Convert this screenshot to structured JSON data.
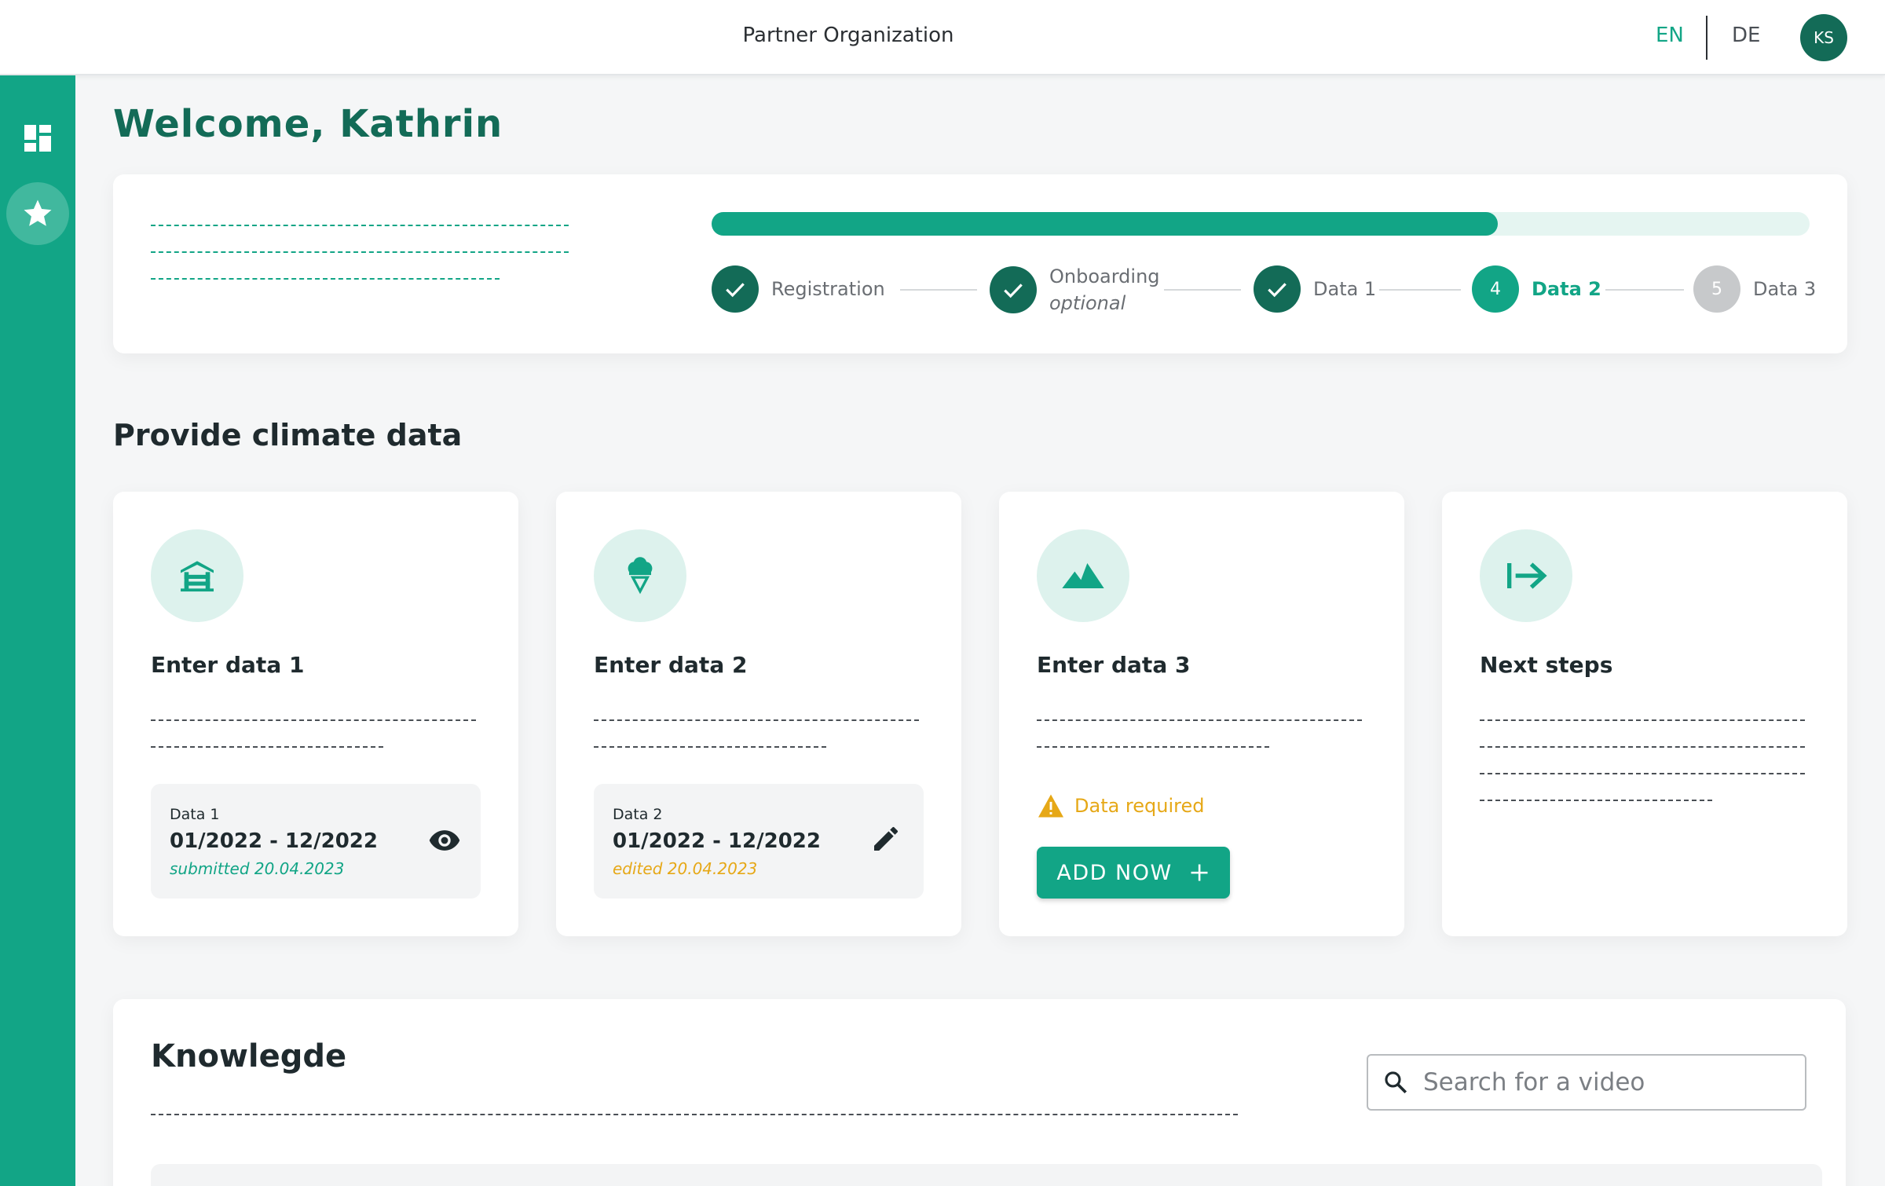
{
  "header": {
    "org_name": "Partner Organization",
    "lang_en": "EN",
    "lang_de": "DE",
    "avatar_initials": "KS"
  },
  "sidebar": {
    "items": [
      {
        "icon": "dashboard-icon"
      },
      {
        "icon": "star-icon"
      }
    ]
  },
  "welcome": "Welcome, Kathrin",
  "progress": {
    "fraction": 0.716,
    "steps": [
      {
        "label": "Registration",
        "state": "done"
      },
      {
        "label": "Onboarding",
        "sublabel": "optional",
        "state": "done"
      },
      {
        "label": "Data 1",
        "state": "done"
      },
      {
        "number": "4",
        "label": "Data 2",
        "state": "active"
      },
      {
        "number": "5",
        "label": "Data 3",
        "state": "todo"
      }
    ]
  },
  "section_title": "Provide climate data",
  "tiles": [
    {
      "icon": "cabin-icon",
      "title": "Enter data 1",
      "box_label": "Data 1",
      "box_range": "01/2022 - 12/2022",
      "box_status": "submitted 20.04.2023",
      "action_icon": "eye-icon"
    },
    {
      "icon": "ice-cream-icon",
      "title": "Enter data 2",
      "box_label": "Data 2",
      "box_range": "01/2022 - 12/2022",
      "box_status": "edited  20.04.2023",
      "action_icon": "pencil-icon"
    },
    {
      "icon": "mountain-icon",
      "title": "Enter data 3",
      "warning": "Data required",
      "button_label": "ADD NOW"
    },
    {
      "icon": "arrow-right-to-bar-icon",
      "title": "Next steps"
    }
  ],
  "knowledge": {
    "title": "Knowlegde",
    "search_placeholder": "Search for a video"
  },
  "colors": {
    "accent": "#12a586",
    "dark_green": "#136b57",
    "amber": "#e6a817"
  }
}
